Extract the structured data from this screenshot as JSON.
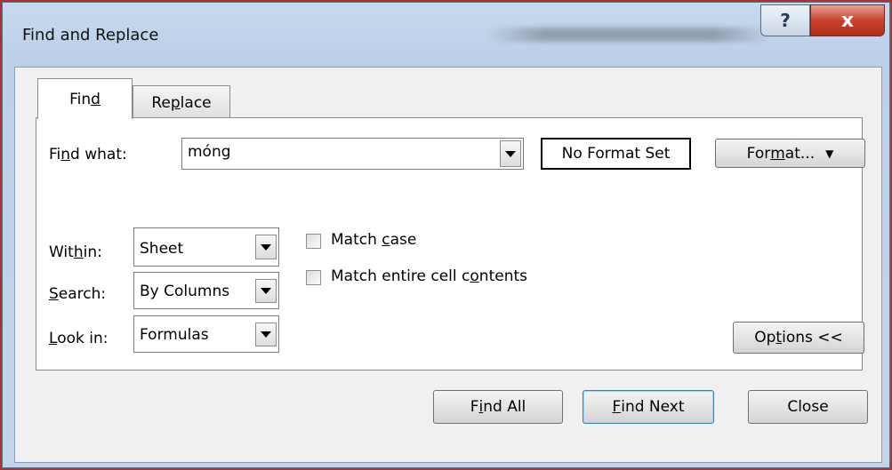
{
  "window": {
    "title": "Find and Replace",
    "help_glyph": "?",
    "close_glyph": "x"
  },
  "tabs": {
    "find": {
      "pre": "Fin",
      "key": "d",
      "post": ""
    },
    "replace": {
      "pre": "Re",
      "key": "p",
      "post": "lace"
    }
  },
  "find_what": {
    "label_pre": "Fi",
    "label_key": "n",
    "label_post": "d what:",
    "value": "móng"
  },
  "format_status": "No Format Set",
  "format_button": {
    "pre": "For",
    "key": "m",
    "post": "at..."
  },
  "within": {
    "label_pre": "Wit",
    "label_key": "h",
    "label_post": "in:",
    "value": "Sheet"
  },
  "search": {
    "label_pre": "",
    "label_key": "S",
    "label_post": "earch:",
    "value": "By Columns"
  },
  "look_in": {
    "label_pre": "",
    "label_key": "L",
    "label_post": "ook in:",
    "value": "Formulas"
  },
  "match_case": {
    "pre": "Match ",
    "key": "c",
    "post": "ase",
    "checked": false
  },
  "match_entire": {
    "pre": "Match entire cell c",
    "key": "o",
    "post": "ntents",
    "checked": false
  },
  "options_button": {
    "pre": "Op",
    "key": "t",
    "post": "ions <<"
  },
  "buttons": {
    "find_all": {
      "pre": "F",
      "key": "i",
      "post": "nd All"
    },
    "find_next": {
      "pre": "",
      "key": "F",
      "post": "ind Next"
    },
    "close": {
      "label": "Close"
    }
  }
}
